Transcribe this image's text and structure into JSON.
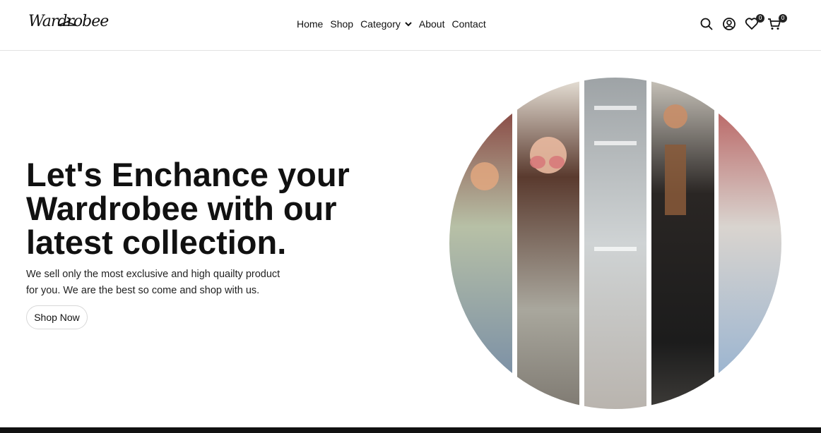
{
  "brand": {
    "logo_text": "Wardrobee"
  },
  "nav": {
    "items": [
      {
        "label": "Home"
      },
      {
        "label": "Shop"
      },
      {
        "label": "Category"
      },
      {
        "label": "About"
      },
      {
        "label": "Contact"
      }
    ]
  },
  "header_icons": {
    "search": "search-icon",
    "account": "user-circle-icon",
    "wishlist": {
      "icon": "heart-icon",
      "count": "0"
    },
    "cart": {
      "icon": "cart-icon",
      "count": "0"
    }
  },
  "hero": {
    "title": "Let's Enchance your Wardrobee with our latest collection.",
    "description": "We sell only the most exclusive and high quailty product for you. We are the best so come and shop with us.",
    "cta_label": "Shop Now"
  },
  "colors": {
    "text": "#111111",
    "border": "#e2e2e2",
    "badge": "#222222"
  }
}
